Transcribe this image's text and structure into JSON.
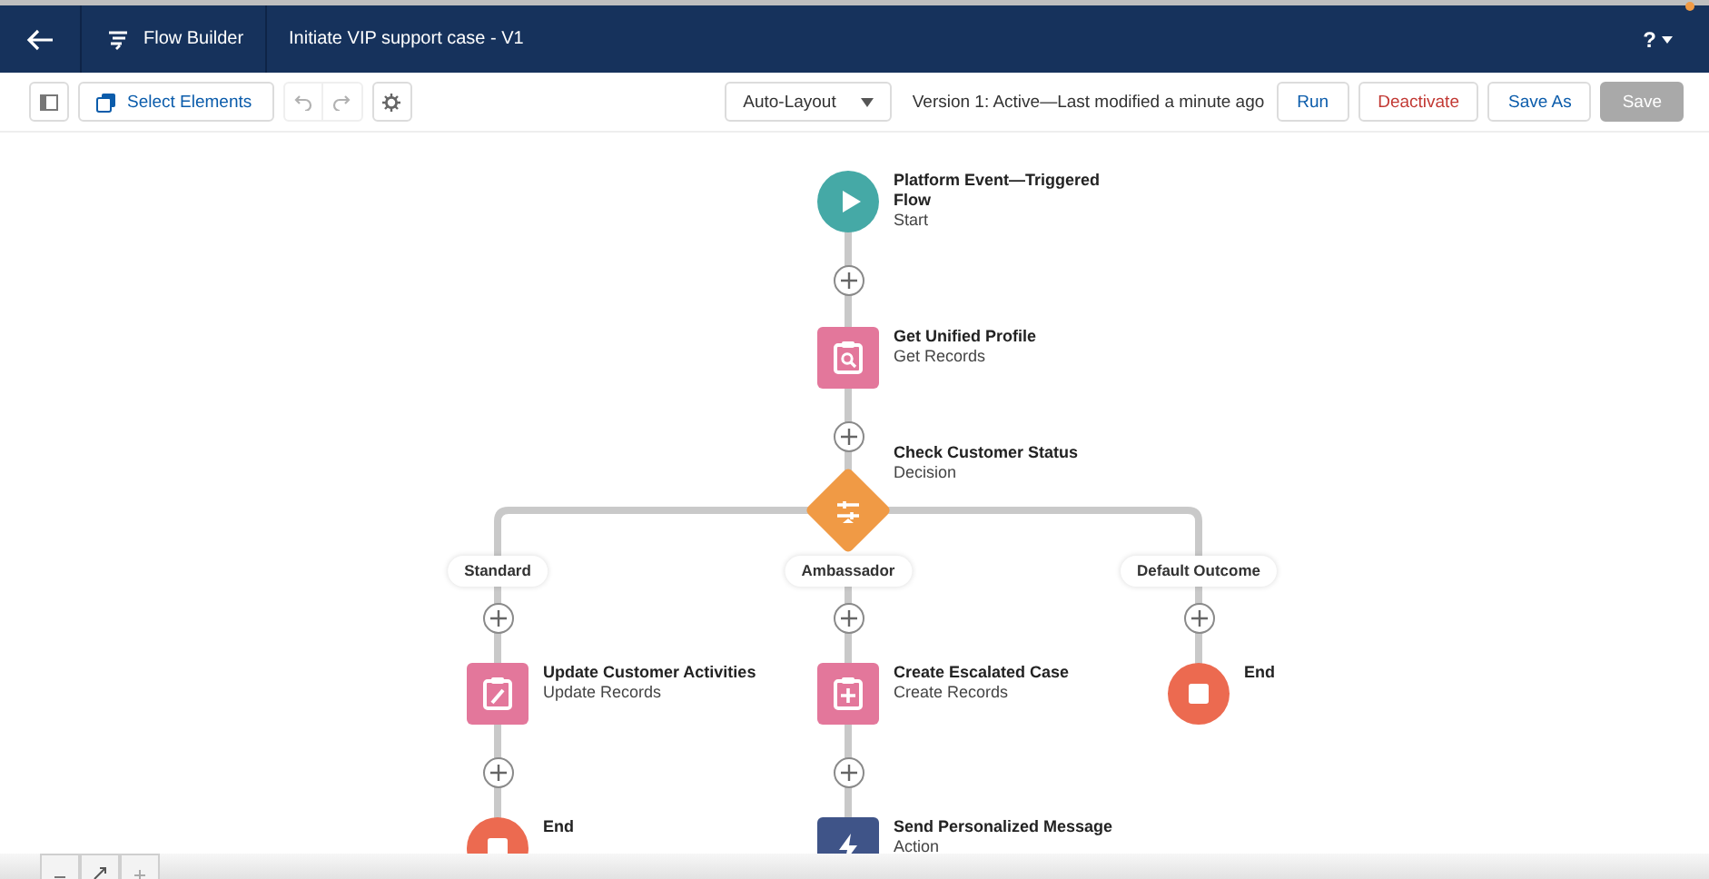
{
  "header": {
    "app_name": "Flow Builder",
    "flow_title": "Initiate VIP support case - V1",
    "help": "?"
  },
  "toolbar": {
    "select_elements": "Select Elements",
    "undo": {
      "disabled": true
    },
    "redo": {
      "disabled": true
    },
    "layout": "Auto-Layout",
    "version_status": "Version 1: Active—Last modified a minute ago",
    "buttons": [
      {
        "label": "Run",
        "kind": "neutral",
        "disabled": false
      },
      {
        "label": "Deactivate",
        "kind": "destructive",
        "disabled": false
      },
      {
        "label": "Save As",
        "kind": "neutral",
        "disabled": false
      },
      {
        "label": "Save",
        "kind": "brand",
        "disabled": true
      }
    ]
  },
  "flow": {
    "steps": [
      {
        "kind": "start",
        "title": "Platform Event—Triggered Flow",
        "subtitle": "Start"
      },
      {
        "kind": "get_records",
        "title": "Get Unified Profile",
        "subtitle": "Get Records"
      },
      {
        "kind": "decision",
        "title": "Check Customer Status",
        "subtitle": "Decision",
        "branches": [
          {
            "label": "Standard",
            "steps": [
              {
                "kind": "update_records",
                "title": "Update Customer Activities",
                "subtitle": "Update Records"
              },
              {
                "kind": "end",
                "title": "End"
              }
            ]
          },
          {
            "label": "Ambassador",
            "steps": [
              {
                "kind": "create_records",
                "title": "Create Escalated Case",
                "subtitle": "Create Records"
              },
              {
                "kind": "action",
                "title": "Send Personalized Message",
                "subtitle": "Action"
              }
            ]
          },
          {
            "label": "Default Outcome",
            "steps": [
              {
                "kind": "end",
                "title": "End"
              }
            ]
          }
        ]
      }
    ]
  }
}
